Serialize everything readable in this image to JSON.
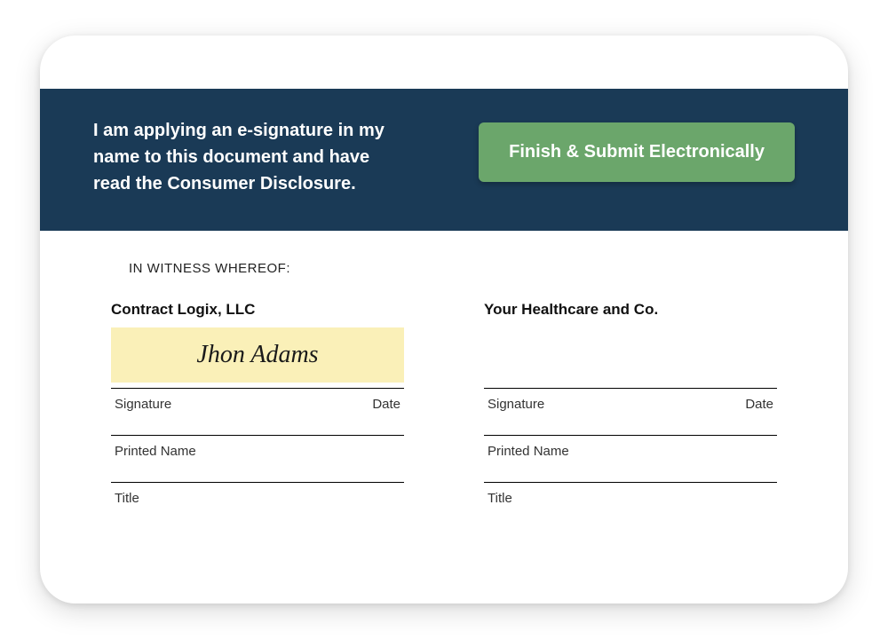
{
  "header": {
    "disclosure": "I am applying an e-signature in my name to this document and have read the Consumer Disclosure.",
    "submit_label": "Finish & Submit Electronically"
  },
  "document": {
    "witness_heading": "IN WITNESS WHEREOF:",
    "parties": [
      {
        "name": "Contract Logix, LLC",
        "signature": "Jhon Adams",
        "highlighted": true
      },
      {
        "name": "Your Healthcare and Co.",
        "signature": "",
        "highlighted": false
      }
    ],
    "labels": {
      "signature": "Signature",
      "date": "Date",
      "printed_name": "Printed Name",
      "title": "Title"
    }
  }
}
